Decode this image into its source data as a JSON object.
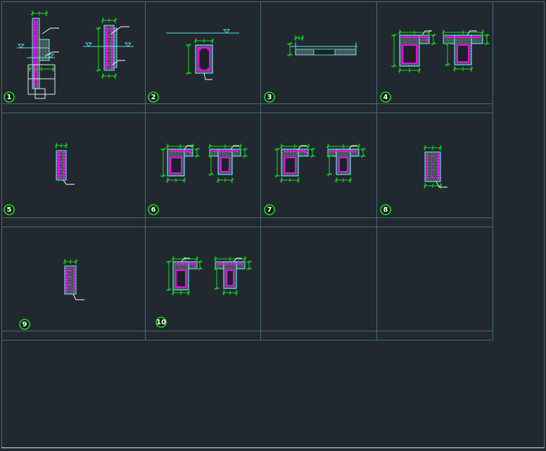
{
  "detail_numbers": [
    "1",
    "2",
    "3",
    "4",
    "5",
    "6",
    "7",
    "8",
    "9",
    "10"
  ],
  "colors": {
    "background": "#212830",
    "grid": "#3f6f77",
    "concrete_outline": "#5fe0e8",
    "rebar": "#ff00ff",
    "dimension": "#18e018",
    "leader": "#ffffff",
    "hatch": "#b0b0b0"
  }
}
